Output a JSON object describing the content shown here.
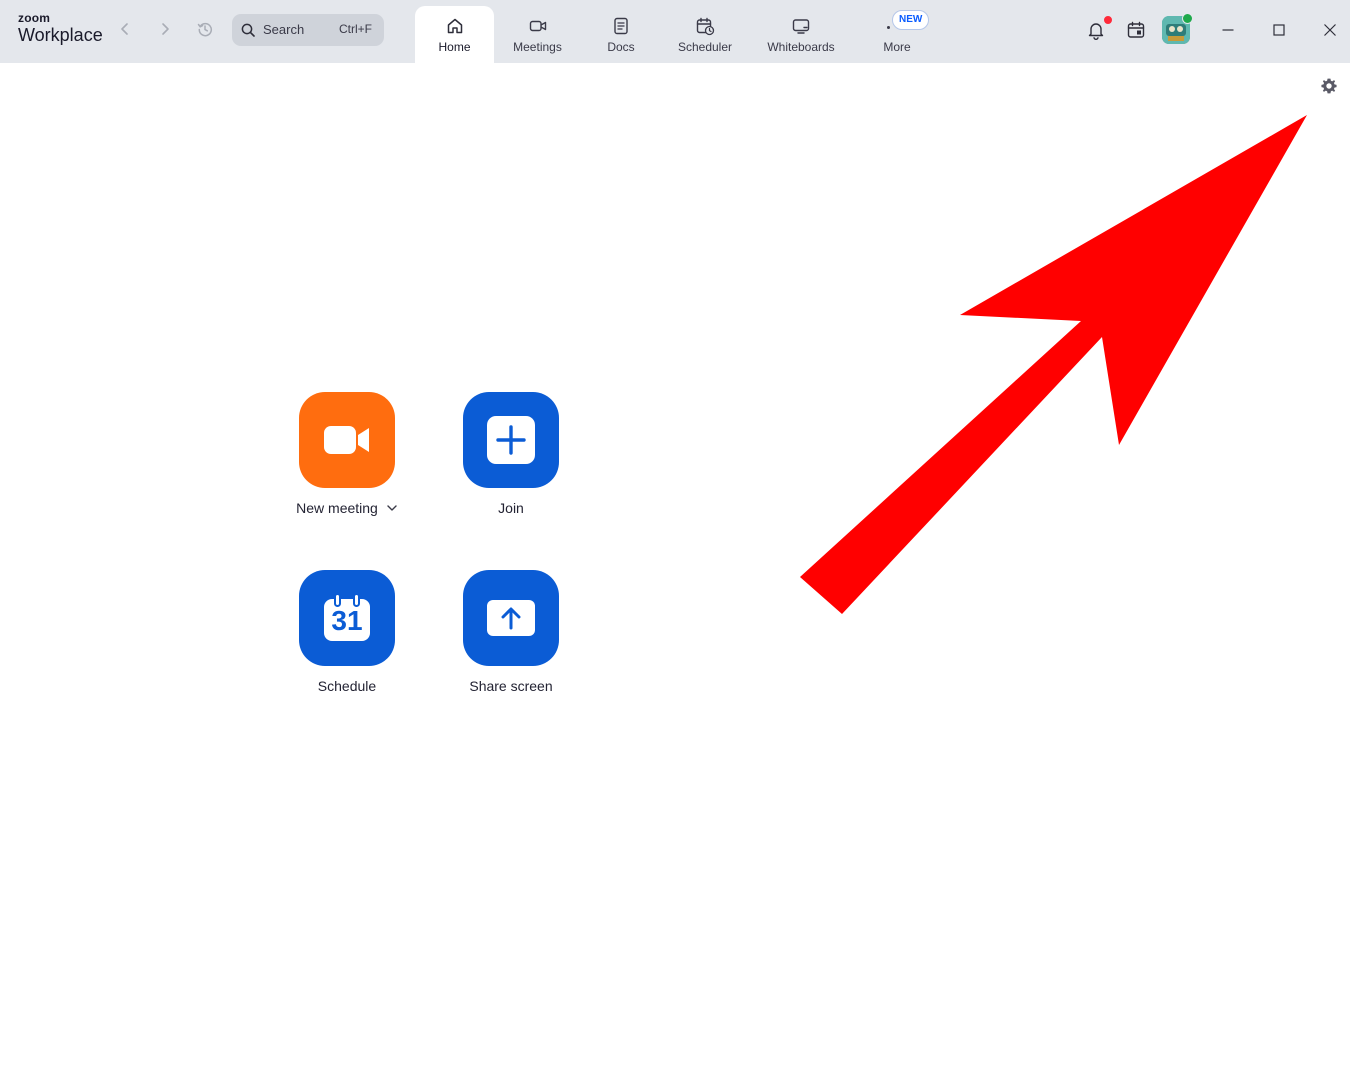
{
  "brand": {
    "small": "zoom",
    "big": "Workplace"
  },
  "search": {
    "placeholder": "Search",
    "shortcut": "Ctrl+F"
  },
  "tabs": [
    {
      "label": "Home"
    },
    {
      "label": "Meetings"
    },
    {
      "label": "Docs"
    },
    {
      "label": "Scheduler"
    },
    {
      "label": "Whiteboards"
    },
    {
      "label": "More"
    }
  ],
  "more_badge": "NEW",
  "actions": {
    "new_meeting": "New meeting",
    "join": "Join",
    "schedule": "Schedule",
    "schedule_day": "31",
    "share_screen": "Share screen"
  },
  "icons": {
    "back": "chevron-left-icon",
    "forward": "chevron-right-icon",
    "history": "history-clock-icon",
    "notifications": "bell-icon",
    "calendar": "calendar-icon",
    "settings": "gear-icon"
  },
  "colors": {
    "accent_blue": "#0b5cd5",
    "accent_orange": "#ff6d0f",
    "annotation_arrow": "#ff0000",
    "notification_dot": "#ff2a3a",
    "presence_online": "#1ea94b"
  }
}
